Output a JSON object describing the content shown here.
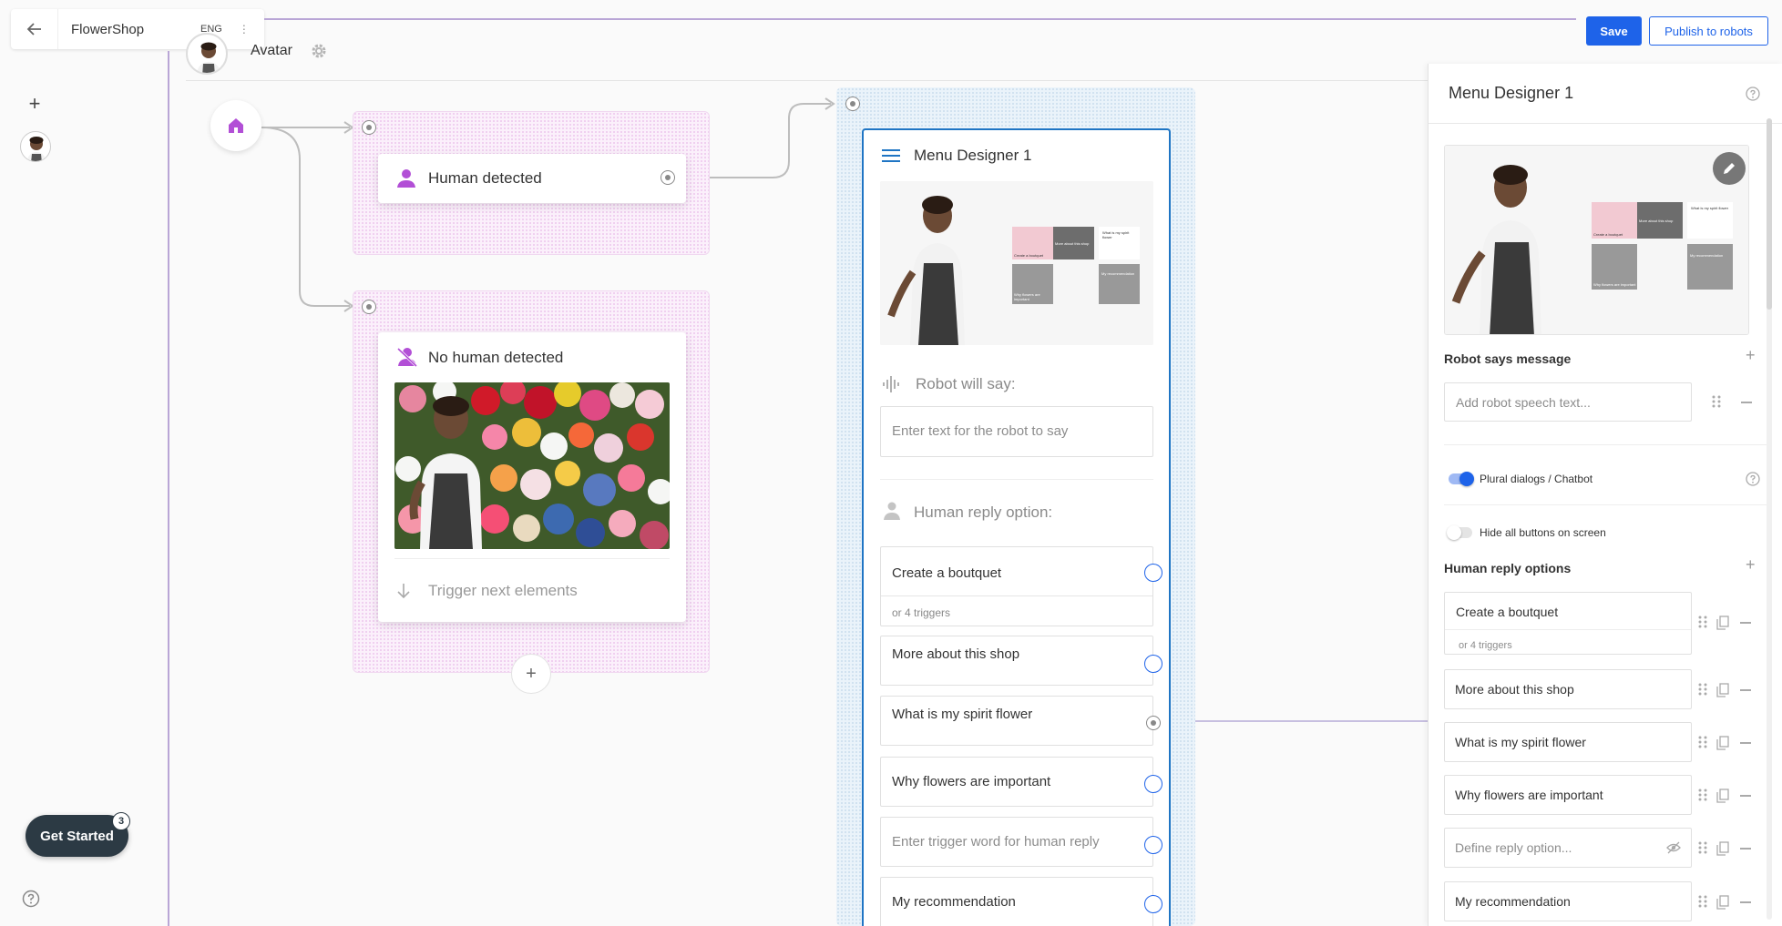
{
  "topbar": {
    "app_title": "FlowerShop",
    "language": "ENG",
    "more": "⋮",
    "save_label": "Save",
    "publish_label": "Publish to robots"
  },
  "sidebar": {
    "add_label": "+",
    "get_started_label": "Get Started",
    "get_started_count": "3"
  },
  "header": {
    "avatar_label": "Avatar"
  },
  "canvas": {
    "human_detected": "Human detected",
    "no_human_detected": "No human detected",
    "trigger_next": "Trigger next elements",
    "add_label": "+"
  },
  "menu_designer": {
    "title": "Menu Designer 1",
    "robot_will_say_label": "Robot will say:",
    "robot_say_placeholder": "Enter text for the robot to say",
    "human_reply_label": "Human reply option:",
    "options": [
      {
        "text": "Create a boutquet",
        "sub": "or 4 triggers"
      },
      {
        "text": "More about this shop"
      },
      {
        "text": "What is my spirit flower"
      },
      {
        "text": "Why flowers are important"
      },
      {
        "placeholder": "Enter trigger word for human reply"
      },
      {
        "text": "My recommendation"
      }
    ],
    "screen_tiles": [
      {
        "label": "Create a boutquet"
      },
      {
        "label": "More about this shop"
      },
      {
        "label": "What is my spirit flower"
      },
      {
        "label": "Why flowers are important"
      },
      {
        "label": "My recommendation"
      }
    ]
  },
  "right_panel": {
    "title": "Menu Designer 1",
    "robot_says_heading": "Robot says message",
    "robot_speech_placeholder": "Add robot speech text...",
    "plural_dialogs_label": "Plural dialogs / Chatbot",
    "hide_buttons_label": "Hide all buttons on screen",
    "human_reply_heading": "Human reply options",
    "options": [
      {
        "text": "Create a boutquet",
        "sub": "or 4 triggers"
      },
      {
        "text": "More about this shop"
      },
      {
        "text": "What is my spirit flower"
      },
      {
        "text": "Why flowers are important"
      },
      {
        "placeholder": "Define reply option..."
      },
      {
        "text": "My recommendation"
      }
    ]
  },
  "colors": {
    "accent": "#1e63e9",
    "purple": "#b24fd6",
    "frame_blue": "#1f75c4",
    "dark_button": "#2c3a44"
  },
  "icons": [
    "back-arrow-icon",
    "home-icon",
    "person-icon",
    "person-off-icon",
    "gear-icon",
    "menu-icon",
    "sound-wave-icon",
    "arrow-down-icon",
    "help-icon",
    "pencil-icon",
    "drag-handle-icon",
    "copy-icon",
    "minus-icon",
    "eye-off-icon",
    "plus-icon"
  ]
}
